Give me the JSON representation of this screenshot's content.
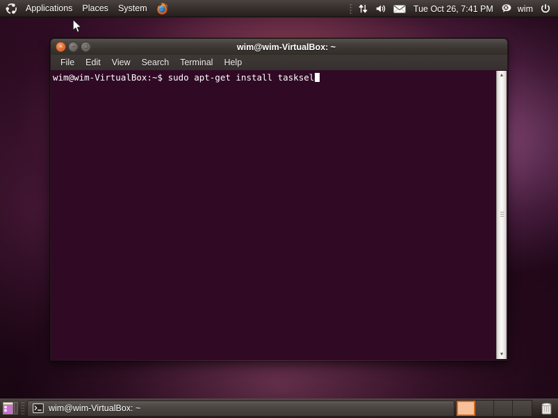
{
  "top_panel": {
    "logo_icon": "ubuntu-logo-icon",
    "menus": [
      {
        "label": "Applications",
        "name": "applications-menu"
      },
      {
        "label": "Places",
        "name": "places-menu"
      },
      {
        "label": "System",
        "name": "system-menu"
      }
    ],
    "launchers": [
      {
        "name": "firefox-launcher-icon",
        "icon": "firefox-icon"
      }
    ],
    "indicators": {
      "network_icon": "network-transfer-icon",
      "volume_icon": "volume-speaker-icon",
      "mail_icon": "envelope-mail-icon",
      "clock": "Tue Oct 26,  7:41 PM",
      "status_icon": "chat-offline-icon",
      "username": "wim",
      "power_icon": "power-button-icon"
    }
  },
  "terminal_window": {
    "title": "wim@wim-VirtualBox: ~",
    "window_buttons": {
      "close": {
        "glyph": "×",
        "name": "close-window-button"
      },
      "minimize": {
        "glyph": "−",
        "name": "minimize-window-button"
      },
      "maximize": {
        "glyph": "□",
        "name": "maximize-window-button"
      }
    },
    "menu_bar": [
      {
        "label": "File",
        "name": "menu-file"
      },
      {
        "label": "Edit",
        "name": "menu-edit"
      },
      {
        "label": "View",
        "name": "menu-view"
      },
      {
        "label": "Search",
        "name": "menu-search"
      },
      {
        "label": "Terminal",
        "name": "menu-terminal"
      },
      {
        "label": "Help",
        "name": "menu-help"
      }
    ],
    "content": {
      "prompt": "wim@wim-VirtualBox:~$ ",
      "command": "sudo apt-get install tasksel",
      "full_line": "wim@wim-VirtualBox:~$ sudo apt-get install tasksel"
    },
    "scrollbar": {
      "up_arrow": "▲",
      "down_arrow": "▼"
    },
    "colors": {
      "background": "#300a24",
      "foreground": "#ffffff",
      "titlebar": "#3a3431"
    }
  },
  "bottom_panel": {
    "show_desktop_icon": "show-desktop-icon",
    "task_button": {
      "label": "wim@wim-VirtualBox: ~",
      "icon": "terminal-icon"
    },
    "workspaces": [
      {
        "index": 1,
        "active": true
      },
      {
        "index": 2,
        "active": false
      },
      {
        "index": 3,
        "active": false
      },
      {
        "index": 4,
        "active": false
      }
    ],
    "trash_icon": "trash-can-icon"
  },
  "colors": {
    "ubuntu_orange": "#dd4814",
    "panel_dark": "#3b3330",
    "terminal_purple": "#300a24",
    "workspace_active": "#f6c09a"
  }
}
